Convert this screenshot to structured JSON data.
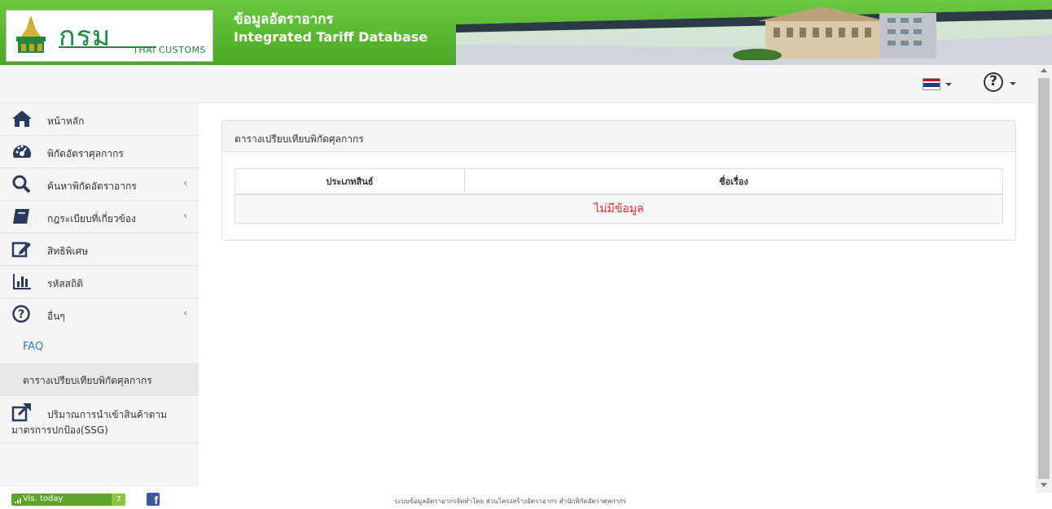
{
  "header": {
    "logo_text": "กรมศุลกากร",
    "logo_sub": "THAI CUSTOMS",
    "title_th": "ข้อมูลอัตราอากร",
    "title_en": "Integrated Tariff Database",
    "brand_green": "#5ebd34"
  },
  "topbar": {
    "language_icon": "thai-flag-icon",
    "help_icon": "question-circle-icon"
  },
  "sidebar": {
    "items": [
      {
        "label": "หน้าหลัก",
        "icon": "home-icon"
      },
      {
        "label": "พิกัดอัตราศุลกากร",
        "icon": "dashboard-icon"
      },
      {
        "label": "ค้นหาพิกัดอัตราอากร",
        "icon": "search-icon",
        "chevron": "‹"
      },
      {
        "label": "กฎระเบียบที่เกี่ยวข้อง",
        "icon": "book-icon",
        "chevron": "‹"
      },
      {
        "label": "สิทธิพิเศษ",
        "icon": "edit-icon"
      },
      {
        "label": "รหัสสถิติ",
        "icon": "bar-chart-icon"
      },
      {
        "label": "อื่นๆ",
        "icon": "question-circle-icon",
        "chevron": "‹"
      }
    ],
    "sub_items": [
      {
        "label": "FAQ"
      },
      {
        "label": "ตารางเปรียบเทียบพิกัดศุลกากร"
      }
    ],
    "ssg": {
      "label_line1": "ปริมาณการนำเข้าสินค้าตาม",
      "label_line2": "มาตรการปกป้อง(SSG)",
      "icon": "external-link-icon"
    }
  },
  "main": {
    "panel_title": "ตารางเปรียบเทียบพิกัดศุลกากร",
    "table": {
      "columns": [
        "ประเภทสินธ์",
        "ชื่อเรื่อง"
      ],
      "empty_text": "ไม่มีข้อมูล"
    }
  },
  "footer": {
    "vis_label": "Vis. today",
    "vis_count": "7",
    "facebook_label": "f",
    "credit": "ระบบข้อมูลอัตราอากรจัดทำโดย ส่วนโครงสร้างอัตราอากร สำนักพิกัดอัตราศุลกากร"
  }
}
